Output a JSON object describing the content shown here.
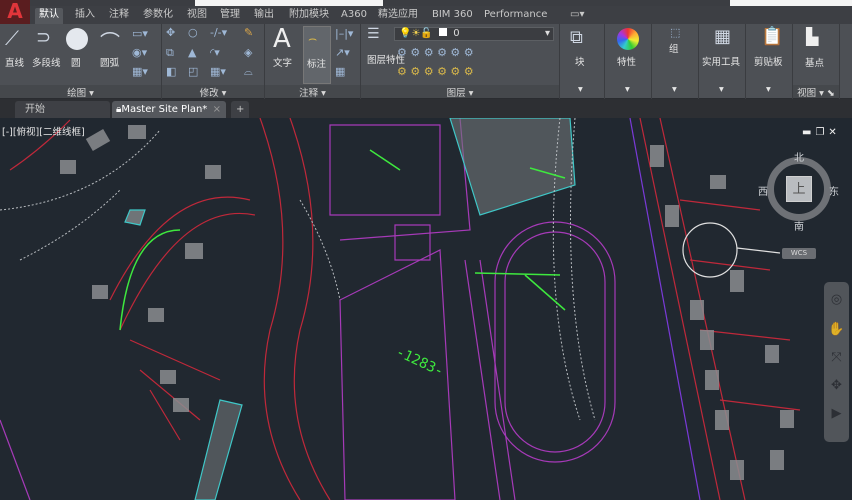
{
  "app": {
    "logo": "A"
  },
  "ribbon_tabs": [
    "默认",
    "插入",
    "注释",
    "参数化",
    "视图",
    "管理",
    "输出",
    "附加模块",
    "A360",
    "精选应用",
    "BIM 360",
    "Performance"
  ],
  "active_tab": "默认",
  "panels": {
    "draw": {
      "label": "绘图",
      "tools": [
        "直线",
        "多段线",
        "圆",
        "圆弧"
      ]
    },
    "modify": {
      "label": "修改"
    },
    "annotation": {
      "label": "注释",
      "tools": [
        "文字",
        "标注"
      ]
    },
    "layers": {
      "label": "图层",
      "tools": [
        "图层特性"
      ],
      "layer_value": "0"
    },
    "block": {
      "label": "块"
    },
    "properties": {
      "label": "特性"
    },
    "groups": {
      "label": "组"
    },
    "utilities": {
      "label": "实用工具"
    },
    "clipboard": {
      "label": "剪贴板"
    },
    "view": {
      "label": "视图",
      "tools": [
        "基点"
      ]
    }
  },
  "doc_tabs": [
    {
      "label": "开始"
    },
    {
      "label": "Master Site Plan*",
      "active": true
    }
  ],
  "viewport": {
    "label": "[-][俯视][二维线框]"
  },
  "viewcube": {
    "north": "北",
    "south": "南",
    "east": "东",
    "west": "西",
    "face": "上",
    "ucs": "WCS"
  },
  "drawing": {
    "labels": [
      "-1283-"
    ]
  },
  "colors": {
    "background": "#212830",
    "roads": "#c0283a",
    "track": "#a63ab8",
    "text": "#3ee83e",
    "hatch": "#3fc7c7"
  }
}
